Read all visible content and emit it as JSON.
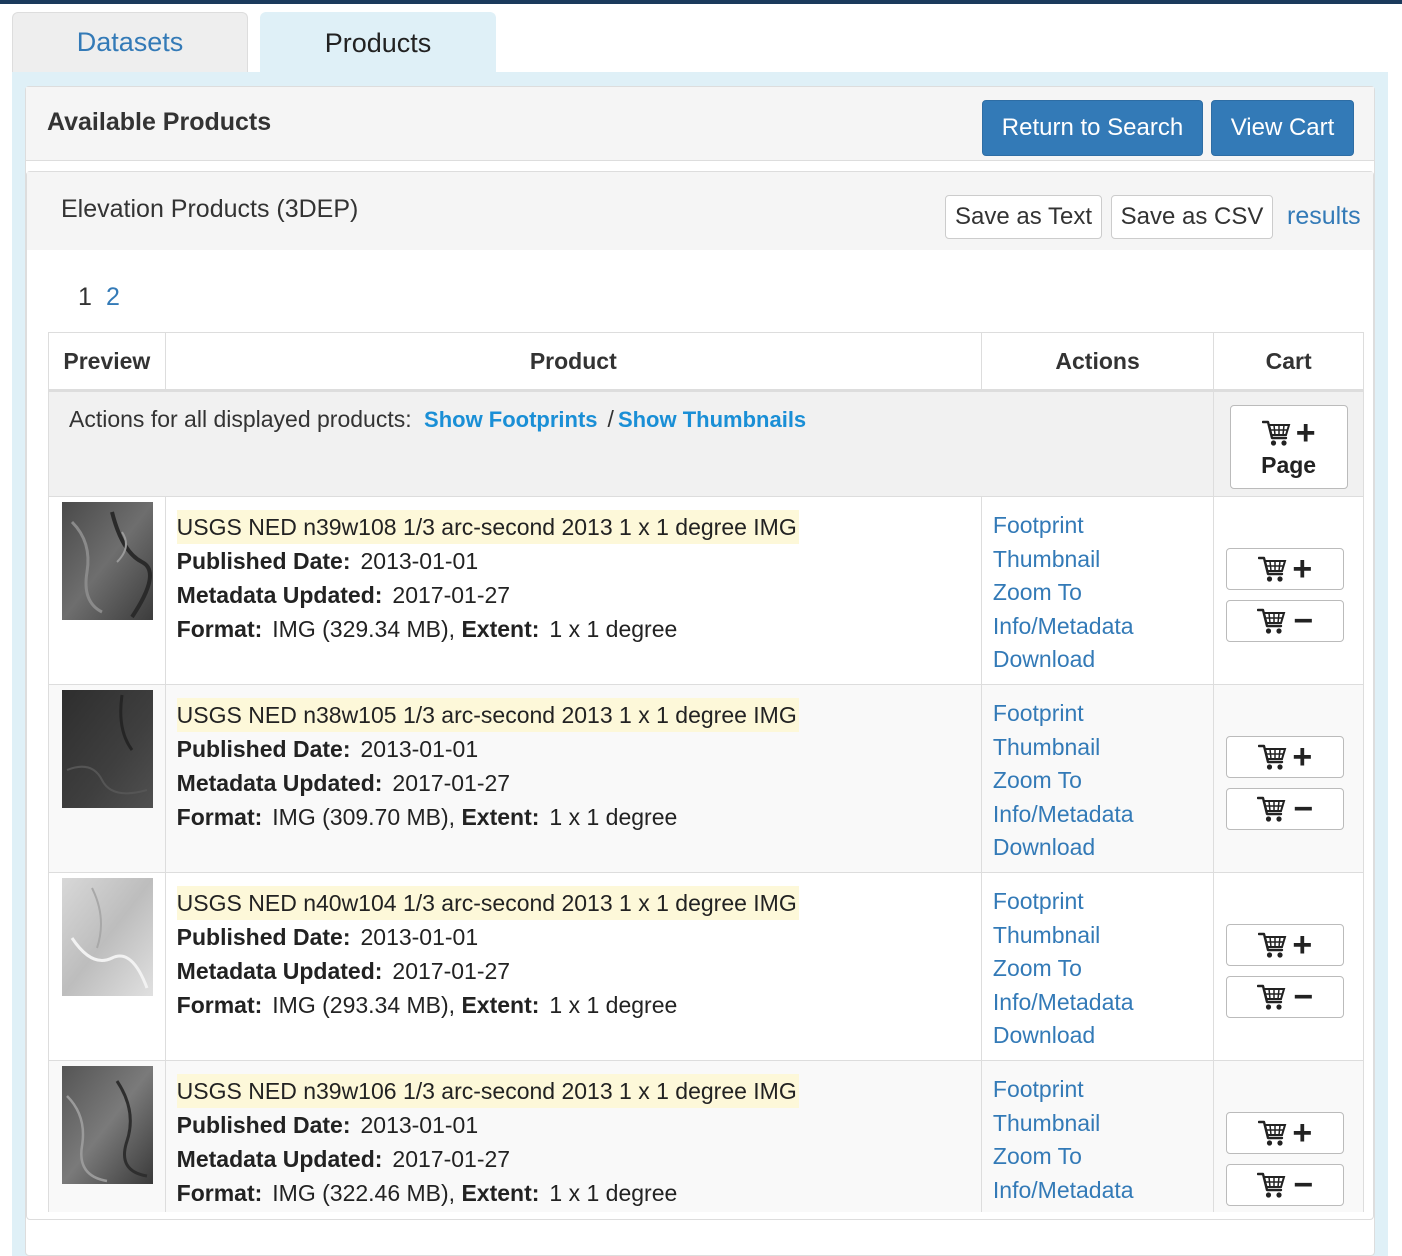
{
  "tabs": [
    {
      "label": "Datasets"
    },
    {
      "label": "Products"
    }
  ],
  "panel": {
    "title": "Available Products",
    "return_button": "Return to Search",
    "view_cart_button": "View Cart"
  },
  "subpanel": {
    "title": "Elevation Products (3DEP)",
    "save_text": "Save as Text",
    "save_csv": "Save as CSV",
    "results_link": "results"
  },
  "pagination": {
    "pages": [
      "1",
      "2"
    ],
    "current": "1"
  },
  "table": {
    "headers": {
      "preview": "Preview",
      "product": "Product",
      "actions": "Actions",
      "cart": "Cart"
    },
    "all_actions": {
      "label": "Actions for all displayed products:",
      "show_footprints": "Show Footprints",
      "separator": "/",
      "show_thumbnails": "Show Thumbnails",
      "page_button": "Page"
    },
    "labels": {
      "published": "Published Date:",
      "metadata": "Metadata Updated:",
      "format": "Format:",
      "extent": "Extent:"
    },
    "actions": [
      "Footprint",
      "Thumbnail",
      "Zoom To",
      "Info/Metadata",
      "Download"
    ],
    "rows": [
      {
        "title": "USGS NED n39w108 1/3 arc-second 2013 1 x 1 degree IMG",
        "published": "2013-01-01",
        "metadata": "2017-01-27",
        "format": "IMG (329.34 MB),",
        "extent": "1 x 1 degree"
      },
      {
        "title": "USGS NED n38w105 1/3 arc-second 2013 1 x 1 degree IMG",
        "published": "2013-01-01",
        "metadata": "2017-01-27",
        "format": "IMG (309.70 MB),",
        "extent": "1 x 1 degree"
      },
      {
        "title": "USGS NED n40w104 1/3 arc-second 2013 1 x 1 degree IMG",
        "published": "2013-01-01",
        "metadata": "2017-01-27",
        "format": "IMG (293.34 MB),",
        "extent": "1 x 1 degree"
      },
      {
        "title": "USGS NED n39w106 1/3 arc-second 2013 1 x 1 degree IMG",
        "published": "2013-01-01",
        "metadata": "2017-01-27",
        "format": "IMG (322.46 MB),",
        "extent": "1 x 1 degree"
      }
    ]
  },
  "colors": {
    "primary": "#337ab7",
    "link": "#337ab7",
    "bold_link": "#1a8fd6",
    "title_highlight": "#fdf8d9",
    "tab_active_bg": "#dff0f7",
    "top_bar": "#1b3a5c"
  },
  "icons": {
    "cart": "shopping-cart-icon",
    "add": "plus-icon",
    "remove": "minus-icon"
  }
}
